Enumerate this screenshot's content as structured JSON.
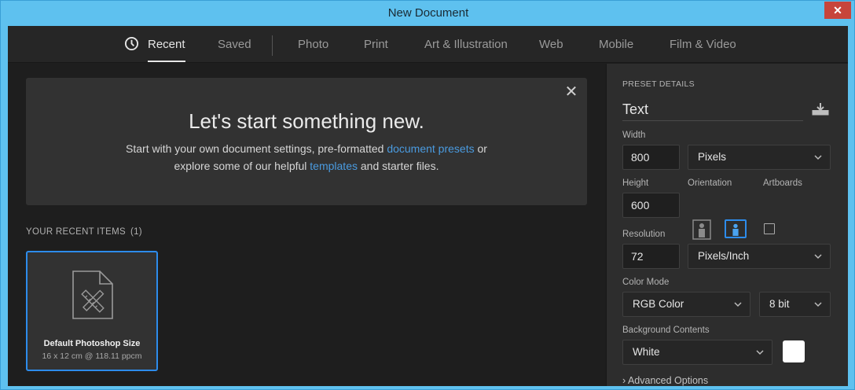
{
  "window": {
    "title": "New Document",
    "close_glyph": "✕"
  },
  "tabs": [
    {
      "label": "Recent",
      "active": true,
      "icon": "clock-icon"
    },
    {
      "label": "Saved"
    },
    {
      "label": "Photo"
    },
    {
      "label": "Print"
    },
    {
      "label": "Art & Illustration"
    },
    {
      "label": "Web"
    },
    {
      "label": "Mobile"
    },
    {
      "label": "Film & Video"
    }
  ],
  "welcome": {
    "heading": "Let's start something new.",
    "line1_a": "Start with your own document settings, pre-formatted ",
    "line1_link": "document presets",
    "line1_b": " or",
    "line2_a": "explore some of our helpful ",
    "line2_link": "templates",
    "line2_b": " and starter files.",
    "close_glyph": "✕"
  },
  "recent": {
    "heading": "YOUR RECENT ITEMS",
    "count": "(1)",
    "items": [
      {
        "name": "Default Photoshop Size",
        "size": "16 x 12 cm @ 118.11 ppcm"
      }
    ]
  },
  "preset": {
    "section_label": "PRESET DETAILS",
    "name": "Text",
    "width_label": "Width",
    "width": "800",
    "width_unit": "Pixels",
    "height_label": "Height",
    "height": "600",
    "orientation_label": "Orientation",
    "artboards_label": "Artboards",
    "artboards_checked": false,
    "resolution_label": "Resolution",
    "resolution": "72",
    "resolution_unit": "Pixels/Inch",
    "color_mode_label": "Color Mode",
    "color_mode": "RGB Color",
    "bit_depth": "8 bit",
    "background_label": "Background Contents",
    "background": "White",
    "background_swatch": "#ffffff",
    "advanced": "Advanced Options"
  },
  "colors": {
    "titlebar": "#5ec1ef",
    "accent": "#2d8ceb",
    "link": "#4a9be0",
    "panel_bg": "#1e1e1e",
    "close_red": "#c7453b"
  }
}
